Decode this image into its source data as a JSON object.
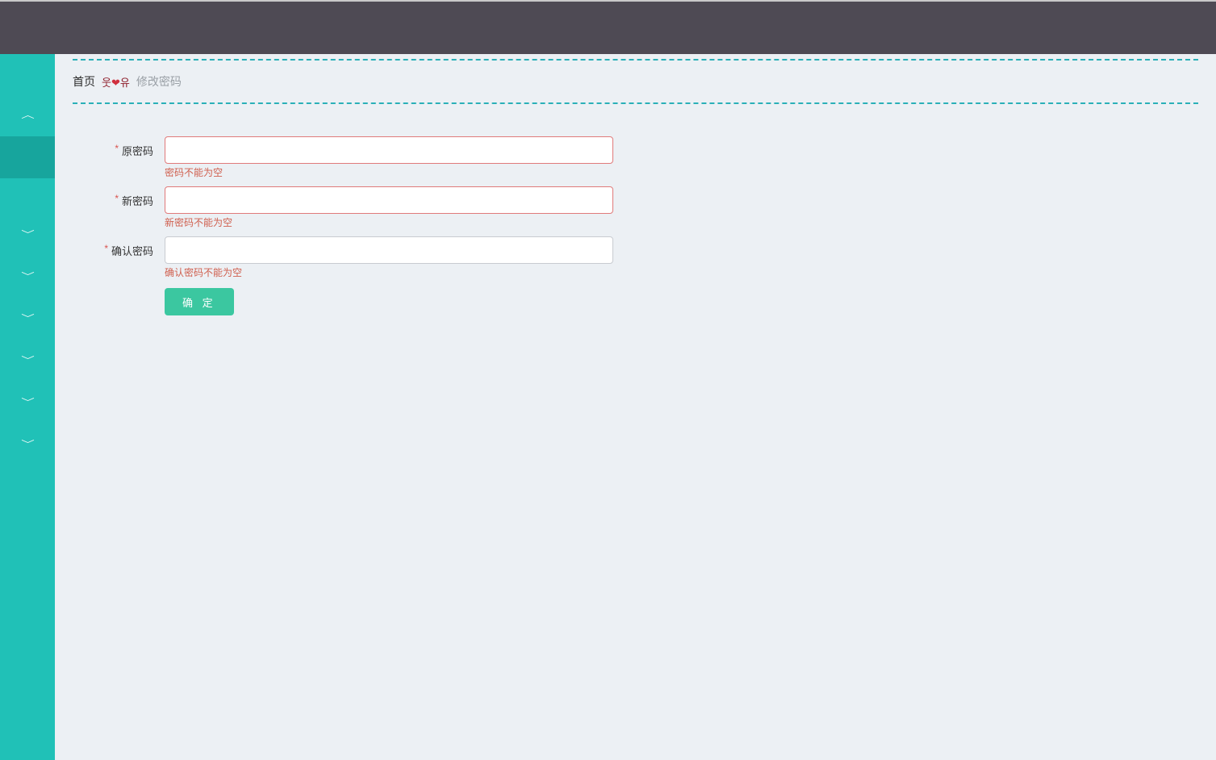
{
  "breadcrumb": {
    "home": "首页",
    "separator_face_left": "웃",
    "separator_face_right": "유",
    "heart": "❤",
    "current": "修改密码"
  },
  "sidebar": {
    "items": [
      {
        "expanded": true
      },
      {
        "active": true
      },
      {
        "expanded": false
      },
      {
        "expanded": false
      },
      {
        "expanded": false
      },
      {
        "expanded": false
      },
      {
        "expanded": false
      },
      {
        "expanded": false
      }
    ]
  },
  "form": {
    "old_password": {
      "label": "原密码",
      "value": "",
      "error": "密码不能为空"
    },
    "new_password": {
      "label": "新密码",
      "value": "",
      "error": "新密码不能为空"
    },
    "confirm_password": {
      "label": "确认密码",
      "value": "",
      "error": "确认密码不能为空"
    },
    "submit_label": "确 定"
  }
}
